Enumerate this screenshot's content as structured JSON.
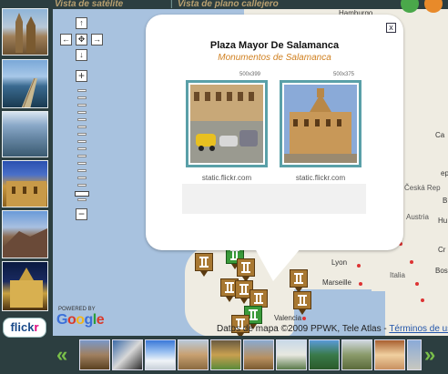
{
  "header": {
    "tab_satellite": "Vista de satélite",
    "tab_separator": "|",
    "tab_street": "Vista de plano callejero"
  },
  "rail": {
    "flickr_prefix": "flick",
    "flickr_suffix": "r"
  },
  "popup": {
    "title": "Plaza Mayor De Salamanca",
    "subtitle": "Monumentos de Salamanca",
    "close_label": "x",
    "photos": [
      {
        "dims": "500x399",
        "source": "static.flickr.com"
      },
      {
        "dims": "500x375",
        "source": "static.flickr.com"
      }
    ]
  },
  "map": {
    "labels": {
      "hamburg": "Hamburgo",
      "czech": "Česká Rep",
      "austria": "Austria",
      "italy": "Italia",
      "lyon": "Lyon",
      "marseille": "Marseille",
      "valencia": "Valencia",
      "hu": "Hu",
      "cr": "Cr",
      "bos": "Bos",
      "b": "B",
      "ca": "Ca",
      "ep": "ep"
    },
    "powered_by": "POWERED BY",
    "google_letters": [
      "G",
      "o",
      "o",
      "g",
      "l",
      "e"
    ],
    "copyright": "Datos de mapa ©2009 PPWK, Tele Atlas - ",
    "terms": "Términos de uso"
  },
  "nav": {
    "up": "↑",
    "down": "↓",
    "left": "←",
    "right": "→",
    "center": "✥",
    "zoom_in": "+",
    "zoom_out": "−"
  },
  "strip": {
    "prev": "«",
    "next": "»"
  },
  "colors": {
    "background": "#2c3e40",
    "accent_gold": "#b8a070",
    "subtitle_orange": "#d08020",
    "photo_border": "#5aa0a8",
    "arrow_green": "#7ac04a",
    "google": [
      "#3b6fd8",
      "#d93a2b",
      "#f2b51c",
      "#3b6fd8",
      "#2a9d3a",
      "#d93a2b"
    ]
  }
}
